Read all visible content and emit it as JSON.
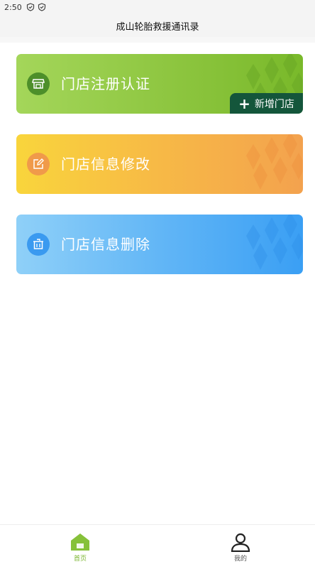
{
  "status_bar": {
    "time": "2:50"
  },
  "header": {
    "title": "成山轮胎救援通讯录"
  },
  "cards": [
    {
      "label": "门店注册认证",
      "icon": "store-icon",
      "action": {
        "label": "新增门店",
        "icon": "plus-icon"
      }
    },
    {
      "label": "门店信息修改",
      "icon": "edit-icon"
    },
    {
      "label": "门店信息删除",
      "icon": "trash-icon"
    }
  ],
  "tabbar": {
    "items": [
      {
        "label": "首页",
        "icon": "home-icon",
        "active": true
      },
      {
        "label": "我的",
        "icon": "user-icon",
        "active": false
      }
    ]
  },
  "colors": {
    "register_card": "#8bc43d",
    "edit_card": "#f7b946",
    "delete_card": "#62b6f6",
    "add_store_button": "#14563b",
    "active_tab": "#7ab42e"
  }
}
